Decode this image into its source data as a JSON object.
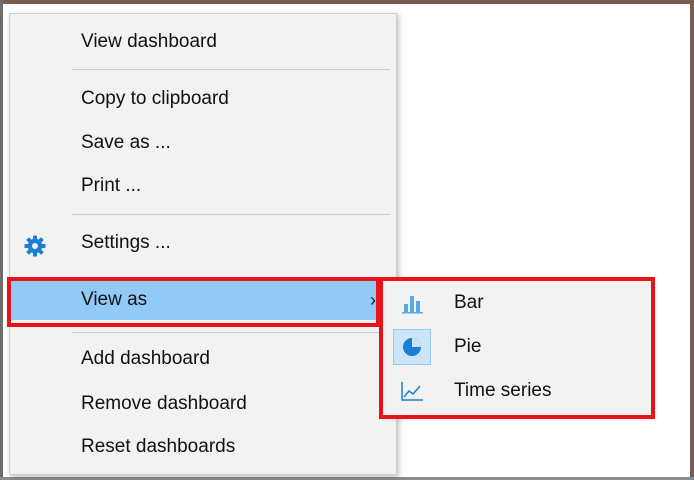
{
  "context_menu": {
    "items": [
      {
        "label": "View dashboard"
      },
      {
        "label": "Copy to clipboard"
      },
      {
        "label": "Save as ..."
      },
      {
        "label": "Print ..."
      },
      {
        "label": "Settings ...",
        "icon": "gear-icon"
      },
      {
        "label": "View as",
        "has_submenu": true,
        "highlighted": true
      },
      {
        "label": "Add dashboard"
      },
      {
        "label": "Remove dashboard"
      },
      {
        "label": "Reset dashboards"
      }
    ],
    "submenu_arrow": "›"
  },
  "view_as_submenu": {
    "items": [
      {
        "label": "Bar",
        "icon": "bar-chart-icon"
      },
      {
        "label": "Pie",
        "icon": "pie-chart-icon",
        "selected": true
      },
      {
        "label": "Time series",
        "icon": "time-series-icon"
      }
    ]
  },
  "colors": {
    "highlight": "#91c9f7",
    "annotation_red": "#e8121a",
    "icon_blue": "#1a7fd4",
    "menu_bg": "#f2f2f2"
  }
}
